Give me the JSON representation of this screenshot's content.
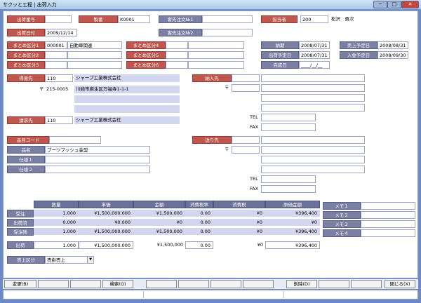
{
  "window": {
    "title": "サクッと工程 | 出荷入力",
    "min": "─",
    "max": "□",
    "close": "✕"
  },
  "header": {
    "shipment_no": {
      "label": "出荷番号",
      "value": ""
    },
    "seiban": {
      "label": "製番",
      "value": "K0001"
    },
    "customer_order1": {
      "label": "客先注文№1",
      "value": ""
    },
    "staff": {
      "label": "担当者",
      "code": "200",
      "name": "松沢　勇次"
    },
    "ship_date": {
      "label": "出荷日付",
      "value": "2009/12/14"
    },
    "customer_order2": {
      "label": "客先注文№2",
      "value": ""
    }
  },
  "groups": [
    {
      "label": "まとめ区分1",
      "code": "000001",
      "name": "自動車関連"
    },
    {
      "label": "まとめ区分2",
      "code": "",
      "name": ""
    },
    {
      "label": "まとめ区分3",
      "code": "",
      "name": ""
    },
    {
      "label": "まとめ区分4",
      "code": "",
      "name": ""
    },
    {
      "label": "まとめ区分5",
      "code": "",
      "name": ""
    },
    {
      "label": "まとめ区分6",
      "code": "",
      "name": ""
    }
  ],
  "dates": {
    "delivery": {
      "label": "納期",
      "value": "2008/07/31"
    },
    "ship_plan": {
      "label": "出荷予定日",
      "value": "2008/07/31"
    },
    "completion": {
      "label": "完成日",
      "value": "____/__/__"
    },
    "sales_plan": {
      "label": "売上予定日",
      "value": "2008/08/31"
    },
    "payment_plan": {
      "label": "入金予定日",
      "value": "2008/09/30"
    }
  },
  "customer": {
    "label": "得意先",
    "code": "110",
    "name": "シャープ工業株式会社",
    "postal_mark": "〒",
    "postal": "215-0005",
    "address": "川崎市麻生区万福寺1-1-1"
  },
  "billing": {
    "label": "請求先",
    "code": "110",
    "name": "シャープ工業株式会社"
  },
  "delivery_to": {
    "label": "納入先",
    "postal_mark": "〒",
    "tel_label": "TEL",
    "fax_label": "FAX"
  },
  "ship_to": {
    "label": "送り先",
    "postal_mark": "〒",
    "tel_label": "TEL",
    "fax_label": "FAX"
  },
  "item": {
    "code_label": "品目コード",
    "name_label": "品名",
    "name_value": "ブーツプッシュ金型",
    "spec1_label": "仕様１",
    "spec2_label": "仕様２"
  },
  "amounts": {
    "headers": [
      "数量",
      "単価",
      "金額",
      "消費税率",
      "消費税",
      "原価金額"
    ],
    "rows": [
      {
        "label": "受注",
        "qty": "1.000",
        "price": "¥1,500,000.000",
        "amount": "¥1,500,000",
        "rate": "0.00",
        "tax": "¥0",
        "cost": "¥396,400"
      },
      {
        "label": "出荷済",
        "qty": "0.000",
        "price": "¥0.000",
        "amount": "¥0",
        "rate": "0.00",
        "tax": "¥0",
        "cost": "¥0"
      },
      {
        "label": "受注残",
        "qty": "1.000",
        "price": "¥1,500,000.000",
        "amount": "¥1,500,000",
        "rate": "0.00",
        "tax": "¥0",
        "cost": "¥396,400"
      }
    ],
    "ship": {
      "label": "出荷",
      "qty": "1.000",
      "price": "¥1,500,000.000",
      "amount": "¥1,500,000",
      "rate": "0.00",
      "tax": "¥0",
      "cost": "¥396,400"
    }
  },
  "memos": [
    "メモ１",
    "メモ２",
    "メモ３",
    "メモ４"
  ],
  "sales_type": {
    "label": "売上区分",
    "value": "売掛売上"
  },
  "fkeys": {
    "change": "変更(B)",
    "search": "検索(G)",
    "delete": "削除(D)",
    "close": "閉じる(X)"
  }
}
